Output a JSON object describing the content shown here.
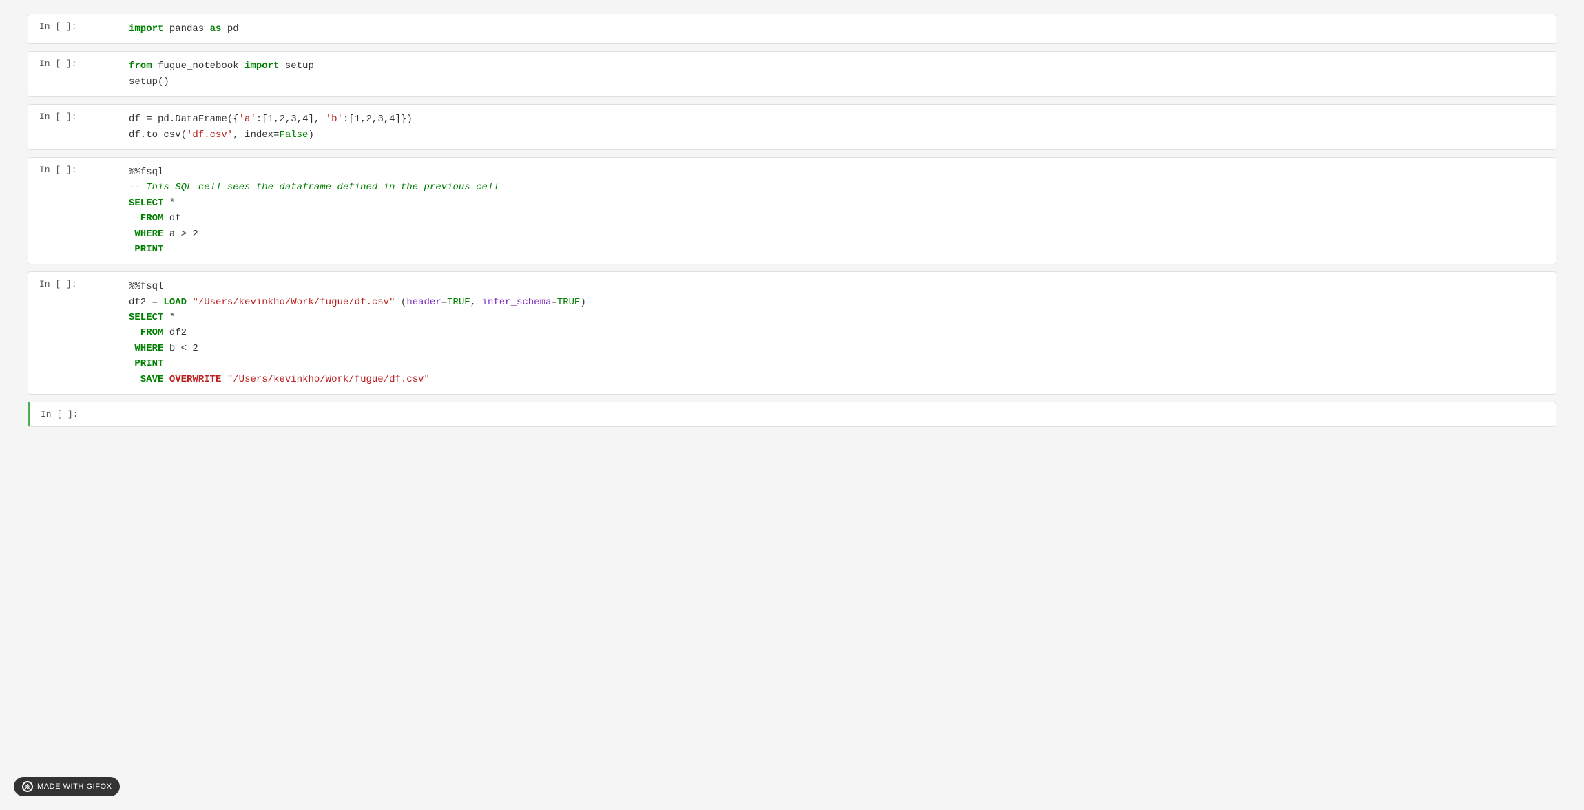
{
  "notebook": {
    "cells": [
      {
        "id": "cell-1",
        "prompt": "In [ ]:",
        "active": false,
        "lines": [
          {
            "parts": [
              {
                "text": "import",
                "cls": "kw-import"
              },
              {
                "text": " pandas ",
                "cls": "kw-var"
              },
              {
                "text": "as",
                "cls": "kw-import"
              },
              {
                "text": " pd",
                "cls": "kw-var"
              }
            ]
          }
        ]
      },
      {
        "id": "cell-2",
        "prompt": "In [ ]:",
        "active": false,
        "lines": [
          {
            "parts": [
              {
                "text": "from",
                "cls": "kw-import"
              },
              {
                "text": " fugue_notebook ",
                "cls": "kw-var"
              },
              {
                "text": "import",
                "cls": "kw-import"
              },
              {
                "text": " setup",
                "cls": "kw-var"
              }
            ]
          },
          {
            "parts": [
              {
                "text": "setup()",
                "cls": "kw-var"
              }
            ]
          }
        ]
      },
      {
        "id": "cell-3",
        "prompt": "In [ ]:",
        "active": false,
        "lines": [
          {
            "parts": [
              {
                "text": "df ",
                "cls": "kw-var"
              },
              {
                "text": "= ",
                "cls": "kw-operator"
              },
              {
                "text": "pd.DataFrame({",
                "cls": "kw-func"
              },
              {
                "text": "'a'",
                "cls": "kw-string"
              },
              {
                "text": ":[1,2,3,4], ",
                "cls": "kw-var"
              },
              {
                "text": "'b'",
                "cls": "kw-string"
              },
              {
                "text": ":[1,2,3,4]})",
                "cls": "kw-var"
              }
            ]
          },
          {
            "parts": [
              {
                "text": "df.to_csv(",
                "cls": "kw-func"
              },
              {
                "text": "'df.csv'",
                "cls": "kw-string"
              },
              {
                "text": ", index=",
                "cls": "kw-var"
              },
              {
                "text": "False",
                "cls": "kw-bool"
              },
              {
                "text": ")",
                "cls": "kw-var"
              }
            ]
          }
        ]
      },
      {
        "id": "cell-4",
        "prompt": "In [ ]:",
        "active": false,
        "lines": [
          {
            "parts": [
              {
                "text": "%%fsql",
                "cls": "kw-magic"
              }
            ]
          },
          {
            "parts": [
              {
                "text": "-- This SQL cell sees the dataframe defined in the previous cell",
                "cls": "kw-comment"
              }
            ]
          },
          {
            "parts": [
              {
                "text": "SELECT",
                "cls": "kw-keyword"
              },
              {
                "text": " *",
                "cls": "kw-var"
              }
            ]
          },
          {
            "parts": [
              {
                "text": "  FROM",
                "cls": "kw-keyword"
              },
              {
                "text": " df",
                "cls": "kw-var"
              }
            ]
          },
          {
            "parts": [
              {
                "text": " WHERE",
                "cls": "kw-keyword"
              },
              {
                "text": " a > 2",
                "cls": "kw-var"
              }
            ]
          },
          {
            "parts": [
              {
                "text": " PRINT",
                "cls": "kw-keyword"
              }
            ]
          }
        ]
      },
      {
        "id": "cell-5",
        "prompt": "In [ ]:",
        "active": false,
        "lines": [
          {
            "parts": [
              {
                "text": "%%fsql",
                "cls": "kw-magic"
              }
            ]
          },
          {
            "parts": [
              {
                "text": "df2 ",
                "cls": "kw-var"
              },
              {
                "text": "= ",
                "cls": "kw-operator"
              },
              {
                "text": "LOAD",
                "cls": "kw-keyword"
              },
              {
                "text": " ",
                "cls": "kw-var"
              },
              {
                "text": "\"/Users/kevinkho/Work/fugue/df.csv\"",
                "cls": "kw-string"
              },
              {
                "text": " (",
                "cls": "kw-var"
              },
              {
                "text": "header",
                "cls": "kw-param"
              },
              {
                "text": "=",
                "cls": "kw-operator"
              },
              {
                "text": "TRUE",
                "cls": "kw-bool"
              },
              {
                "text": ", ",
                "cls": "kw-var"
              },
              {
                "text": "infer_schema",
                "cls": "kw-param"
              },
              {
                "text": "=",
                "cls": "kw-operator"
              },
              {
                "text": "TRUE",
                "cls": "kw-bool"
              },
              {
                "text": ")",
                "cls": "kw-var"
              }
            ]
          },
          {
            "parts": [
              {
                "text": "SELECT",
                "cls": "kw-keyword"
              },
              {
                "text": " *",
                "cls": "kw-var"
              }
            ]
          },
          {
            "parts": [
              {
                "text": "  FROM",
                "cls": "kw-keyword"
              },
              {
                "text": " df2",
                "cls": "kw-var"
              }
            ]
          },
          {
            "parts": [
              {
                "text": " WHERE",
                "cls": "kw-keyword"
              },
              {
                "text": " b < 2",
                "cls": "kw-var"
              }
            ]
          },
          {
            "parts": [
              {
                "text": " PRINT",
                "cls": "kw-keyword"
              }
            ]
          },
          {
            "parts": [
              {
                "text": "  SAVE",
                "cls": "kw-keyword"
              },
              {
                "text": " ",
                "cls": "kw-var"
              },
              {
                "text": "OVERWRITE",
                "cls": "kw-overwrite"
              },
              {
                "text": " ",
                "cls": "kw-var"
              },
              {
                "text": "\"/Users/kevinkho/Work/fugue/df.csv\"",
                "cls": "kw-string"
              }
            ]
          }
        ]
      },
      {
        "id": "cell-6",
        "prompt": "In [ ]:",
        "active": true,
        "lines": [
          {
            "parts": [
              {
                "text": "",
                "cls": "kw-var"
              }
            ]
          }
        ]
      }
    ]
  },
  "badge": {
    "label": "MADE WITH GIFOX"
  }
}
